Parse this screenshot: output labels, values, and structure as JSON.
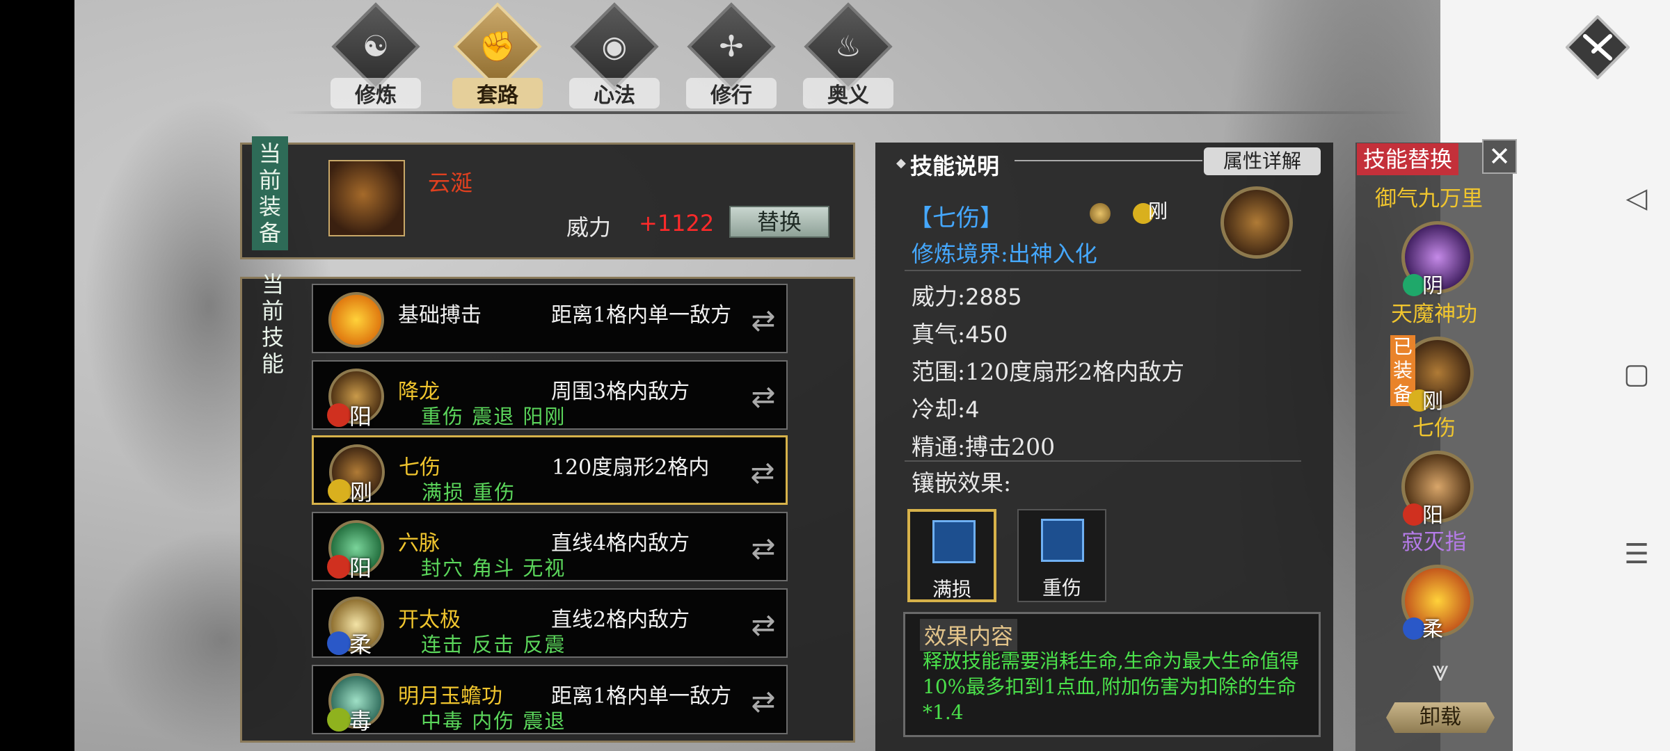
{
  "tabs": [
    {
      "label": "修炼",
      "icon": "yin-yang-icon"
    },
    {
      "label": "套路",
      "icon": "fist-icon",
      "active": true
    },
    {
      "label": "心法",
      "icon": "swirl-icon"
    },
    {
      "label": "修行",
      "icon": "scroll-icon"
    },
    {
      "label": "奥义",
      "icon": "flame-icon"
    }
  ],
  "equip": {
    "section_label": "当前装备",
    "name": "云涎",
    "power_label": "威力",
    "power_value": "+1122",
    "replace_label": "替换"
  },
  "skills": {
    "section_label": "当前技能",
    "rows": [
      {
        "name": "基础搏击",
        "range": "距离1格内单一敌方",
        "tags": "",
        "attr": "",
        "badge": ""
      },
      {
        "name": "降龙",
        "range": "周围3格内敌方",
        "tags": "重伤 震退 阳刚",
        "attr": "阳",
        "badge": "red"
      },
      {
        "name": "七伤",
        "range": "120度扇形2格内",
        "tags": "满损 重伤",
        "attr": "刚",
        "badge": "yellow"
      },
      {
        "name": "六脉",
        "range": "直线4格内敌方",
        "tags": "封穴 角斗 无视",
        "attr": "阳",
        "badge": "red"
      },
      {
        "name": "开太极",
        "range": "直线2格内敌方",
        "tags": "连击 反击 反震",
        "attr": "柔",
        "badge": "blue"
      },
      {
        "name": "明月玉蟾功",
        "range": "距离1格内单一敌方",
        "tags": "中毒 内伤 震退",
        "attr": "毒",
        "badge": "green"
      }
    ]
  },
  "detail": {
    "title": "技能说明",
    "attr_detail_label": "属性详解",
    "skill_name": "【七伤】",
    "attr_mark": "刚",
    "realm": "修炼境界:出神入化",
    "stats": [
      {
        "label": "威力:",
        "value": "2885"
      },
      {
        "label": "真气:",
        "value": "450"
      },
      {
        "label": "范围:",
        "value": "120度扇形2格内敌方"
      },
      {
        "label": "冷却:",
        "value": "4"
      },
      {
        "label": "精通:",
        "value": "搏击200"
      }
    ],
    "inlay_label": "镶嵌效果:",
    "inlays": [
      {
        "label": "满损"
      },
      {
        "label": "重伤"
      }
    ],
    "effect_title": "效果内容",
    "effect_text": "释放技能需要消耗生命,生命为最大生命值得10%最多扣到1点血,附加伤害为扣除的生命*1.4"
  },
  "replace": {
    "title": "技能替换",
    "top_name": "御气九万里",
    "items": [
      {
        "name": "天魔神功",
        "attr": "阴"
      },
      {
        "name": "七伤",
        "attr": "刚",
        "equipped_label": "已装备"
      },
      {
        "name": "寂灭指",
        "attr": "阳"
      },
      {
        "name": "",
        "attr": "柔"
      }
    ],
    "unload_label": "卸载"
  }
}
